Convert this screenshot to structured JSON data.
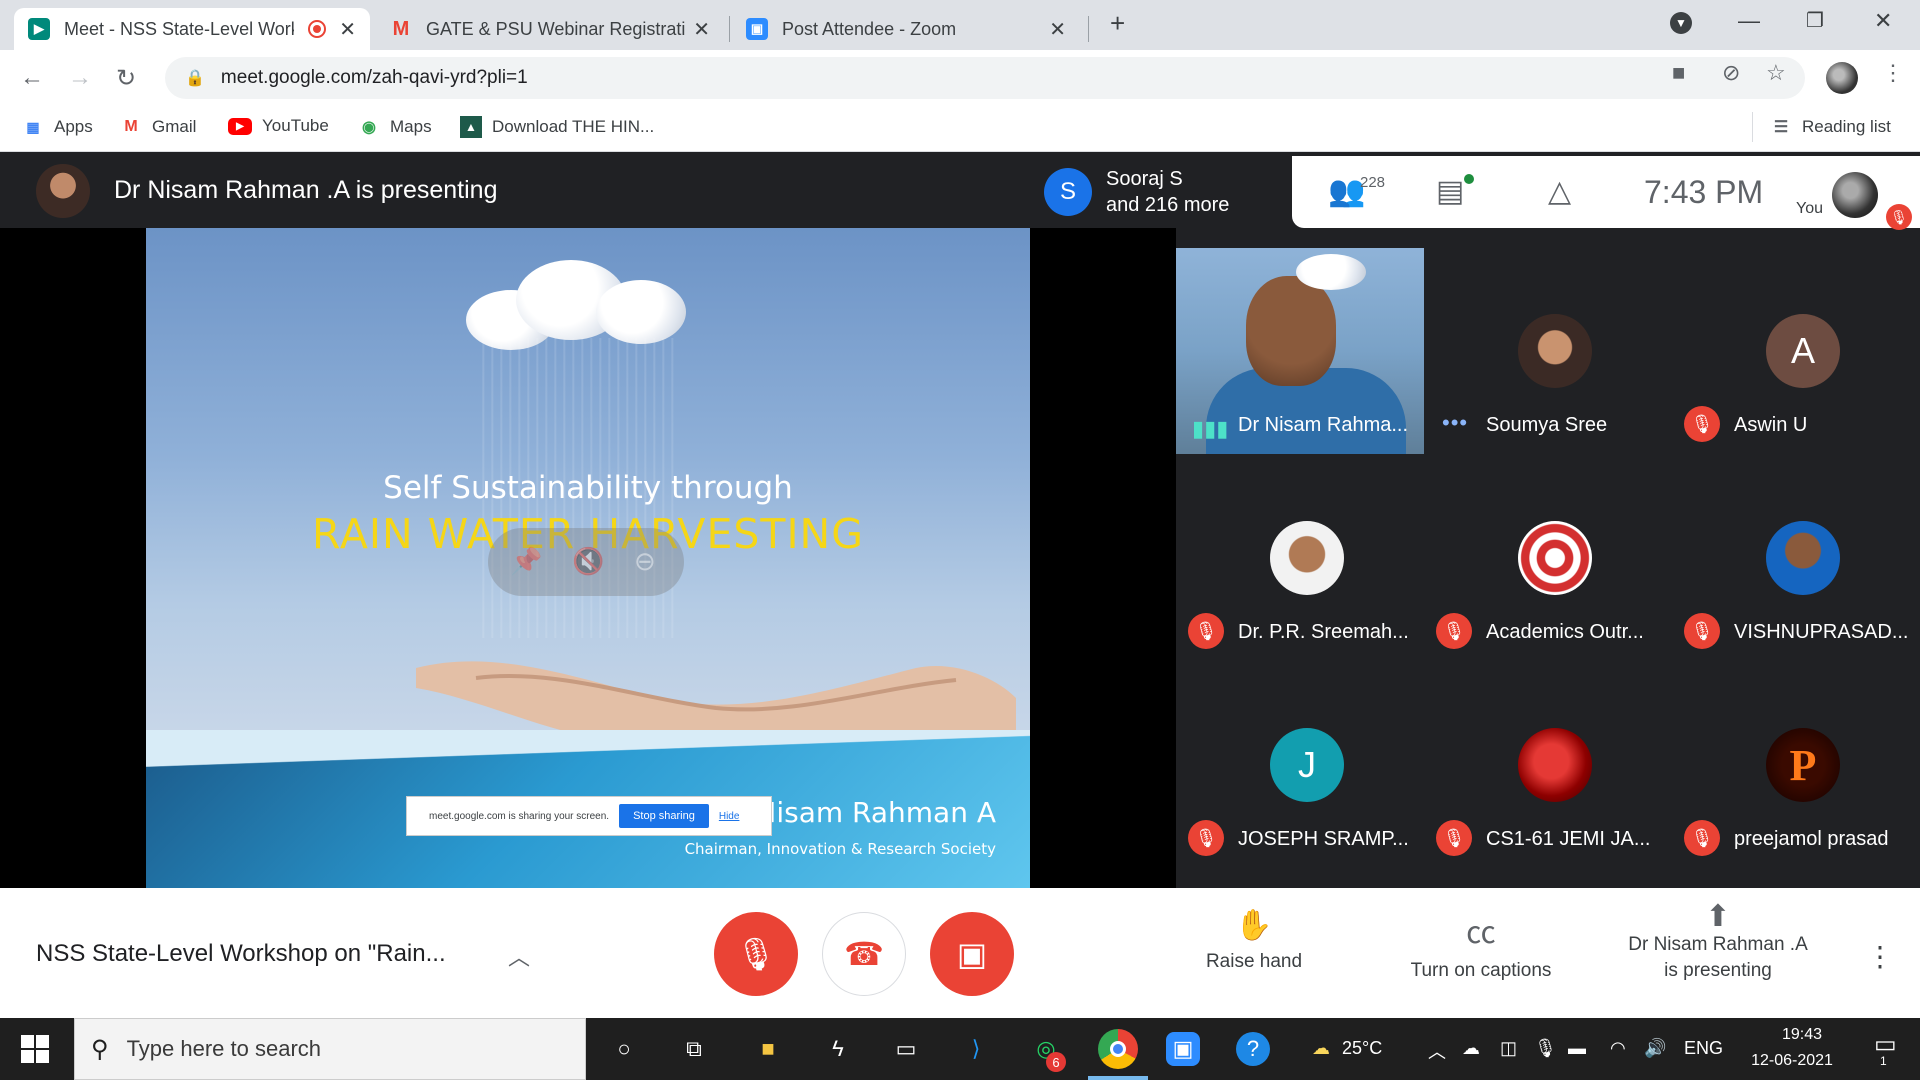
{
  "browser": {
    "tabs": [
      {
        "title": "Meet - NSS State-Level Work",
        "icon": "google-meet-icon",
        "active": true,
        "recording": true
      },
      {
        "title": "GATE & PSU Webinar Registratio",
        "icon": "gmail-icon",
        "active": false
      },
      {
        "title": "Post Attendee - Zoom",
        "icon": "zoom-icon",
        "active": false
      }
    ],
    "url": "meet.google.com/zah-qavi-yrd?pli=1",
    "bookmarks": [
      {
        "label": "Apps",
        "icon": "apps-grid-icon"
      },
      {
        "label": "Gmail",
        "icon": "gmail-icon"
      },
      {
        "label": "YouTube",
        "icon": "youtube-icon"
      },
      {
        "label": "Maps",
        "icon": "maps-icon"
      },
      {
        "label": "Download THE HIN...",
        "icon": "bookmark-page-icon"
      }
    ],
    "reading_list": "Reading list"
  },
  "meet": {
    "presenting_label": "Dr Nisam Rahman .A is presenting",
    "joined_initial": "S",
    "joined_line1": "Sooraj S",
    "joined_line2": "and 216 more",
    "people_count": "228",
    "clock": "7:43  PM",
    "you_label": "You",
    "slide": {
      "subtitle": "Self Sustainability through",
      "title": "RAIN WATER HARVESTING",
      "author": "Prof. Dr. Nisam Rahman A",
      "role": "Chairman, Innovation & Research Society",
      "share_text": "meet.google.com is sharing your screen.",
      "share_stop": "Stop sharing",
      "share_hide": "Hide"
    },
    "participants": [
      {
        "name": "Dr Nisam Rahma...",
        "speaking": true
      },
      {
        "name": "Soumya Sree",
        "status": "more-options"
      },
      {
        "name": "Aswin U",
        "initial": "A",
        "muted": true,
        "color": "#6d4c41"
      },
      {
        "name": "Dr. P.R. Sreemah...",
        "muted": true
      },
      {
        "name": "Academics Outr...",
        "muted": true
      },
      {
        "name": "VISHNUPRASAD...",
        "muted": true
      },
      {
        "name": "JOSEPH SRAMP...",
        "initial": "J",
        "muted": true,
        "color": "#129eaf"
      },
      {
        "name": "CS1-61 JEMI JA...",
        "muted": true
      },
      {
        "name": "preejamol prasad",
        "initial": "P",
        "muted": true
      }
    ],
    "meeting_title": "NSS State-Level Workshop on \"Rain...",
    "actions": {
      "raise_hand": "Raise hand",
      "captions": "Turn on captions",
      "present_line1": "Dr Nisam Rahman .A",
      "present_line2": "is presenting"
    }
  },
  "taskbar": {
    "search_placeholder": "Type here to search",
    "whatsapp_badge": "6",
    "weather": "25°C",
    "language": "ENG",
    "time": "19:43",
    "date": "12-06-2021",
    "notifications": "1"
  },
  "colors": {
    "meet_red": "#ea4335",
    "meet_dark": "#202124",
    "chrome_blue": "#1a73e8",
    "slide_title_yellow": "#f5d617"
  }
}
